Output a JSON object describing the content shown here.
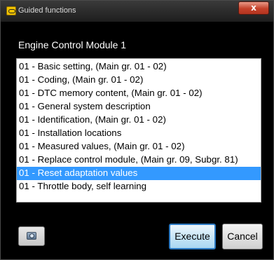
{
  "window": {
    "title": "Guided functions",
    "close_label": "x"
  },
  "module": {
    "title": "Engine Control Module 1"
  },
  "functions": {
    "items": [
      {
        "label": "01 - Basic setting, (Main gr. 01 - 02)",
        "selected": false
      },
      {
        "label": "01 - Coding, (Main gr. 01 - 02)",
        "selected": false
      },
      {
        "label": "01 - DTC memory content, (Main gr. 01 - 02)",
        "selected": false
      },
      {
        "label": "01 - General system description",
        "selected": false
      },
      {
        "label": "01 - Identification, (Main gr. 01 - 02)",
        "selected": false
      },
      {
        "label": "01 - Installation locations",
        "selected": false
      },
      {
        "label": "01 - Measured values, (Main gr. 01 - 02)",
        "selected": false
      },
      {
        "label": "01 - Replace control module, (Main gr. 09, Subgr. 81)",
        "selected": false
      },
      {
        "label": "01 - Reset adaptation values",
        "selected": true
      },
      {
        "label": "01 - Throttle body, self learning",
        "selected": false
      }
    ]
  },
  "buttons": {
    "execute_label": "Execute",
    "cancel_label": "Cancel"
  },
  "colors": {
    "selection": "#3399ff",
    "window_background": "#000000",
    "close_button": "#c4412a"
  },
  "icons": {
    "app": "vehicle-diagnostic-icon",
    "screenshot": "camera-icon",
    "close": "close-icon"
  }
}
